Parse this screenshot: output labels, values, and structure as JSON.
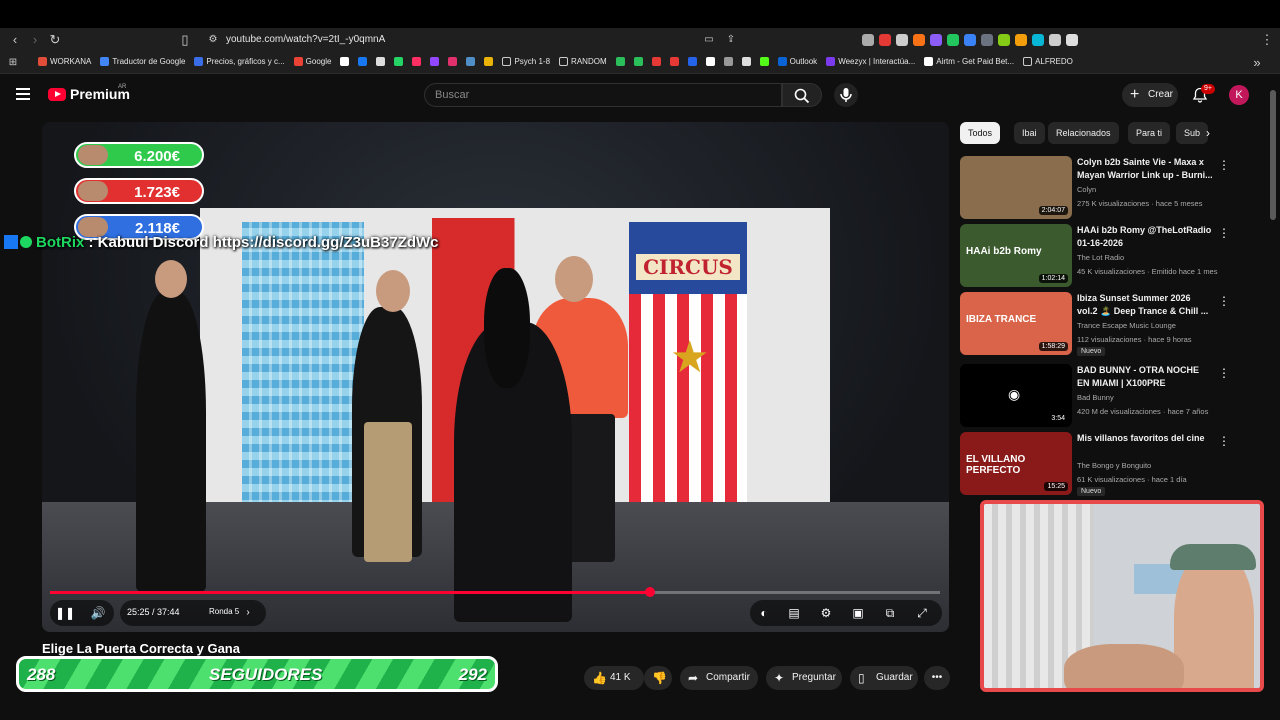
{
  "browser": {
    "url": "youtube.com/watch?v=2tI_-y0qmnA",
    "bookmarks": [
      {
        "label": "WORKANA",
        "color": "#e04e39"
      },
      {
        "label": "Traductor de Google",
        "color": "#4285f4"
      },
      {
        "label": "Precios, gráficos y c...",
        "color": "#3a6ee8"
      },
      {
        "label": "Google",
        "color": "#ea4335"
      },
      {
        "label": "",
        "color": "#ffffff"
      },
      {
        "label": "",
        "color": "#1877f2"
      },
      {
        "label": "",
        "color": "#dddddd"
      },
      {
        "label": "",
        "color": "#25d366"
      },
      {
        "label": "",
        "color": "#ff2e63"
      },
      {
        "label": "",
        "color": "#9146ff"
      },
      {
        "label": "",
        "color": "#e1306c"
      },
      {
        "label": "",
        "color": "#4f8ec6"
      },
      {
        "label": "",
        "color": "#eab308"
      },
      {
        "label": "Psych 1-8",
        "color": "#cccccc",
        "folder": true
      },
      {
        "label": "RANDOM",
        "color": "#cccccc",
        "folder": true
      },
      {
        "label": "",
        "color": "#2bbf5c"
      },
      {
        "label": "",
        "color": "#2bbf5c"
      },
      {
        "label": "",
        "color": "#e53935"
      },
      {
        "label": "",
        "color": "#e53935"
      },
      {
        "label": "",
        "color": "#2563eb"
      },
      {
        "label": "",
        "color": "#ffffff"
      },
      {
        "label": "",
        "color": "#999999"
      },
      {
        "label": "",
        "color": "#dddddd"
      },
      {
        "label": "",
        "color": "#53fc18"
      },
      {
        "label": "Outlook",
        "color": "#0a64d6"
      },
      {
        "label": "Weezyx | Interactúa...",
        "color": "#7c3aed"
      },
      {
        "label": "Airtm - Get Paid Bet...",
        "color": "#ffffff"
      },
      {
        "label": "ALFREDO",
        "color": "#cccccc",
        "folder": true
      }
    ],
    "extension_colors": [
      "#aaaaaa",
      "#e53935",
      "#cccccc",
      "#f97316",
      "#8b5cf6",
      "#22c55e",
      "#3b82f6",
      "#6b7280",
      "#84cc16",
      "#f59e0b",
      "#06b6d4",
      "#cccccc",
      "#dddddd"
    ]
  },
  "youtube": {
    "logo_text": "Premium",
    "country": "AR",
    "search_placeholder": "Buscar",
    "create_label": "Crear",
    "notification_count": "9+",
    "avatar_letter": "K"
  },
  "player": {
    "time": "25:25 / 37:44",
    "chapter": "Ronda 5",
    "progress_fraction": 0.674,
    "door_sign": "CIRCUS",
    "overlay_scores": [
      {
        "value": "6.200€",
        "color": "#2fc94c"
      },
      {
        "value": "1.723€",
        "color": "#e23030"
      },
      {
        "value": "2.118€",
        "color": "#2f6fe0"
      }
    ],
    "chat_user": "BotRix",
    "chat_message": ": Kabuul Discord https://discord.gg/Z3uB37ZdWc"
  },
  "video": {
    "title": "Elige La Puerta Correcta y Gana",
    "likes": "41 K",
    "share_label": "Compartir",
    "ask_label": "Preguntar",
    "save_label": "Guardar"
  },
  "stream_overlay": {
    "followers_current": "288",
    "followers_label": "SEGUIDORES",
    "followers_goal": "292"
  },
  "chips": [
    "Todos",
    "Ibai",
    "Relacionados",
    "Para ti",
    "Sub"
  ],
  "recommendations": [
    {
      "title": "Colyn b2b Sainte Vie - Maxa x Mayan Warrior Link up - Burni...",
      "channel": "Colyn",
      "meta": "275 K visualizaciones · hace 5 meses",
      "duration": "2:04:07",
      "badge": "",
      "thumb": "#8a6d4c"
    },
    {
      "title": "HAAi b2b Romy @TheLotRadio 01-16-2026",
      "channel": "The Lot Radio",
      "meta": "45 K visualizaciones · Emitido hace 1 mes",
      "duration": "1:02:14",
      "badge": "",
      "thumb": "#3b5a2e",
      "thumb_text": "HAAi b2b Romy"
    },
    {
      "title": "Ibiza Sunset Summer 2026 vol.2 🏝️ Deep Trance & Chill ...",
      "channel": "Trance Escape Music Lounge",
      "meta": "112 visualizaciones · hace 9 horas",
      "duration": "1:58:29",
      "badge": "Nuevo",
      "thumb": "#d9644a",
      "thumb_text": "IBIZA TRANCE"
    },
    {
      "title": "BAD BUNNY - OTRA NOCHE EN MIAMI | X100PRE [Visualizer]",
      "channel": "Bad Bunny",
      "meta": "420 M de visualizaciones · hace 7 años",
      "duration": "3:54",
      "badge": "",
      "thumb": "#000000"
    },
    {
      "title": "Mis villanos favoritos del cine",
      "channel": "The Bongo y Bonguito",
      "meta": "61 K visualizaciones · hace 1 día",
      "duration": "15:25",
      "badge": "Nuevo",
      "thumb": "#8a1a1a",
      "thumb_text": "EL VILLANO PERFECTO"
    }
  ]
}
